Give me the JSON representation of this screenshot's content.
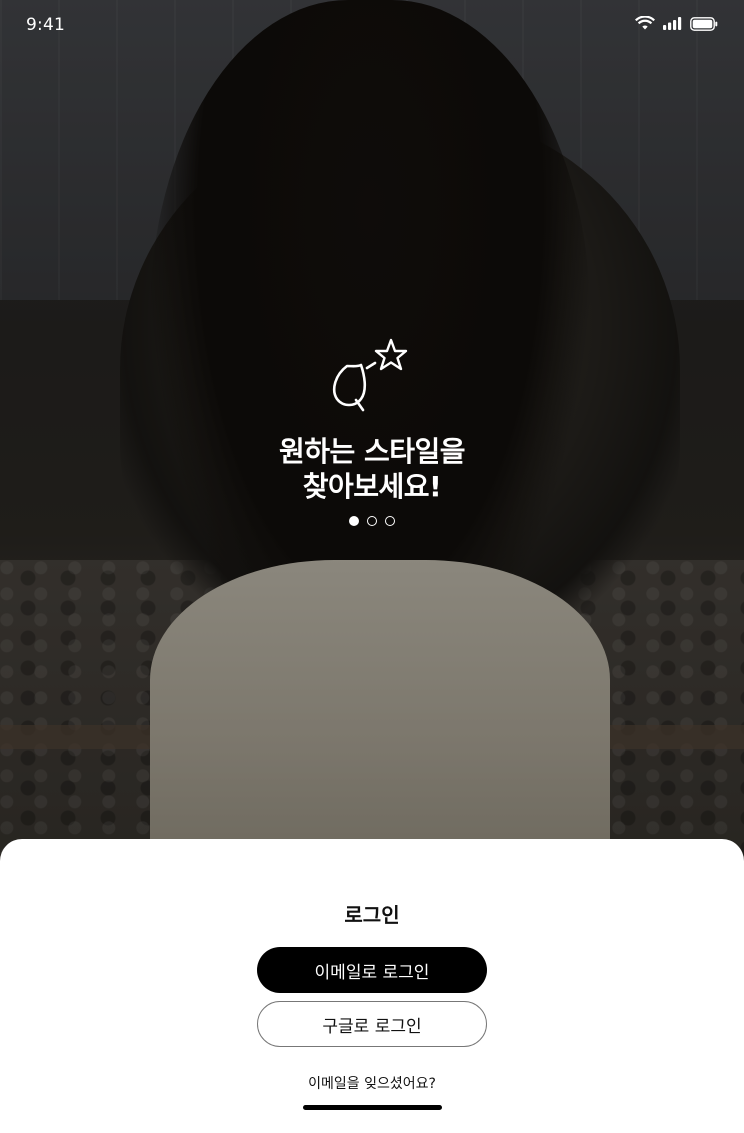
{
  "status_bar": {
    "time": "9:41"
  },
  "onboarding": {
    "title_line1": "원하는 스타일을",
    "title_line2": "찾아보세요!",
    "page_indicator": {
      "total": 3,
      "active_index": 0
    }
  },
  "login": {
    "title": "로그인",
    "email_button": "이메일로 로그인",
    "google_button": "구글로 로그인",
    "forgot_link": "이메일을 잊으셨어요?"
  },
  "icons": [
    "wifi-icon",
    "signal-icon",
    "battery-icon",
    "leaf-star-logo-icon"
  ],
  "colors": {
    "primary_button": "#000000",
    "sheet_background": "#ffffff",
    "hero_text": "#ffffff"
  }
}
